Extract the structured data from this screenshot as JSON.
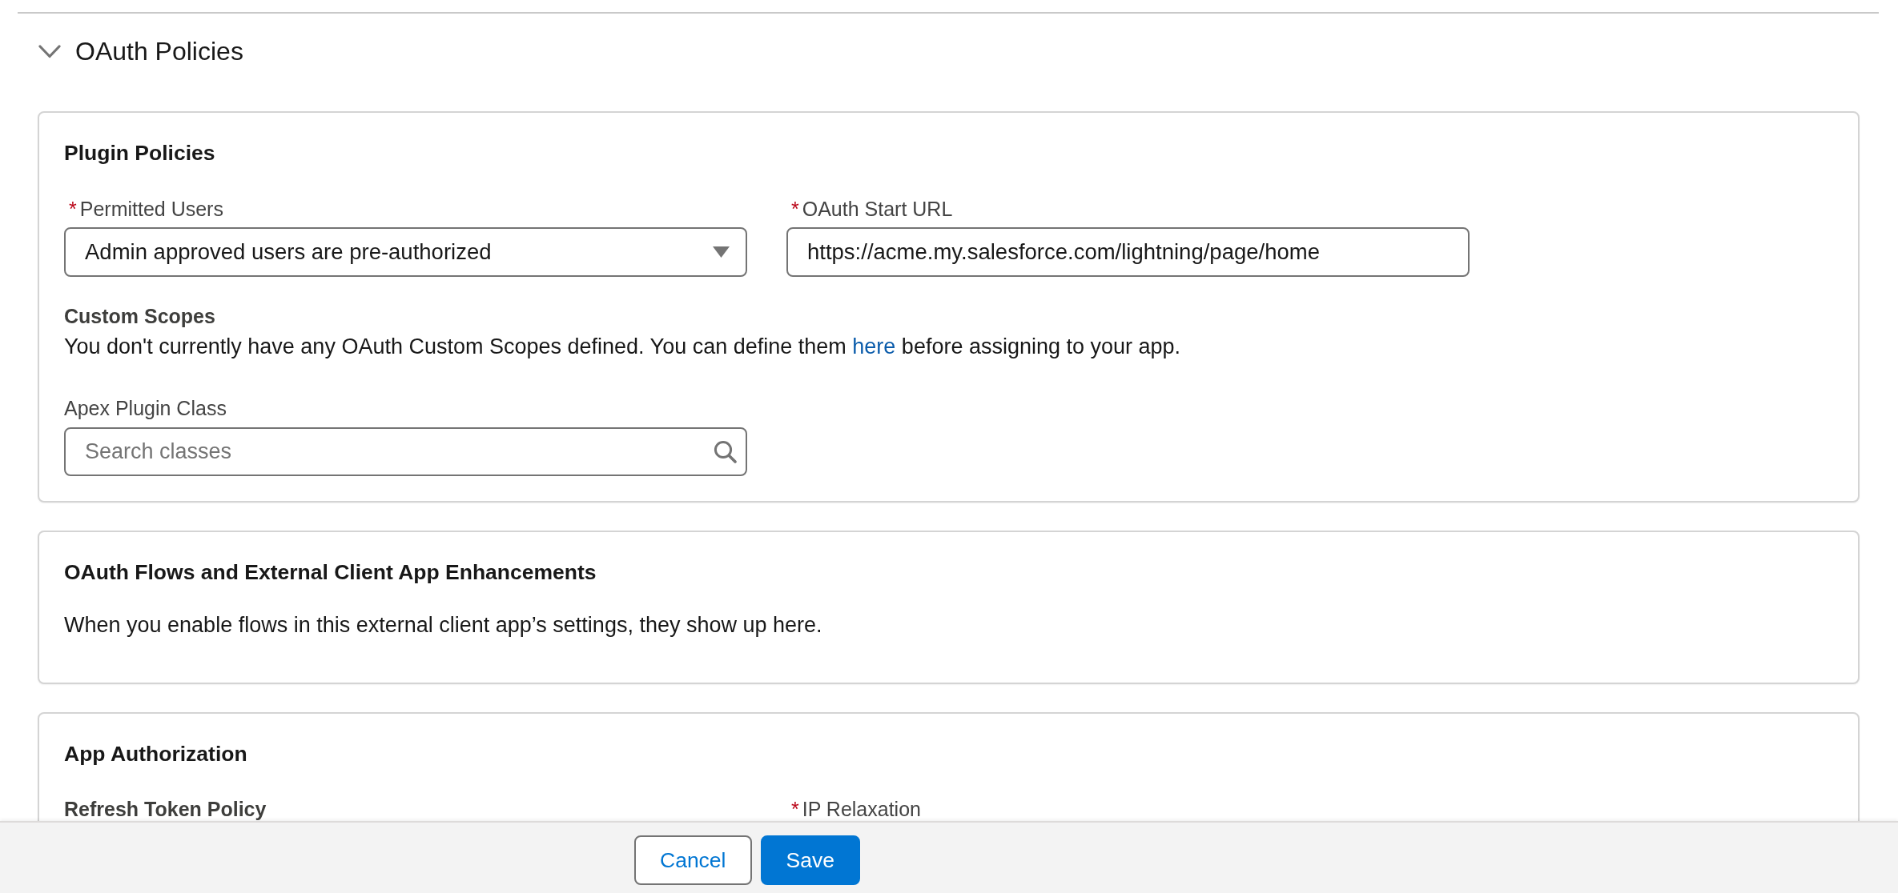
{
  "section": {
    "title": "OAuth Policies",
    "expanded": true
  },
  "plugin_policies": {
    "title": "Plugin Policies",
    "permitted_users": {
      "required_mark": "*",
      "label": "Permitted Users",
      "value": "Admin approved users are pre-authorized"
    },
    "oauth_start_url": {
      "required_mark": "*",
      "label": "OAuth Start URL",
      "value": "https://acme.my.salesforce.com/lightning/page/home"
    },
    "custom_scopes": {
      "label": "Custom Scopes",
      "message_start": "You don't currently have any OAuth Custom Scopes defined. You can define them",
      "link": "here",
      "message_end": "before assigning to your app."
    },
    "apex_plugin_class": {
      "label": "Apex Plugin Class",
      "placeholder": "Search classes"
    }
  },
  "oauth_flows": {
    "title": "OAuth Flows and External Client App Enhancements",
    "message": "When you enable flows in this external client app’s settings, they show up here."
  },
  "app_authorization": {
    "title": "App Authorization",
    "refresh_token_policy": {
      "label": "Refresh Token Policy"
    },
    "ip_relaxation": {
      "required_mark": "*",
      "label": "IP Relaxation"
    }
  },
  "footer": {
    "buttons": [
      {
        "label": "Cancel",
        "kind": "neutral"
      },
      {
        "label": "Save",
        "kind": "brand"
      }
    ]
  }
}
